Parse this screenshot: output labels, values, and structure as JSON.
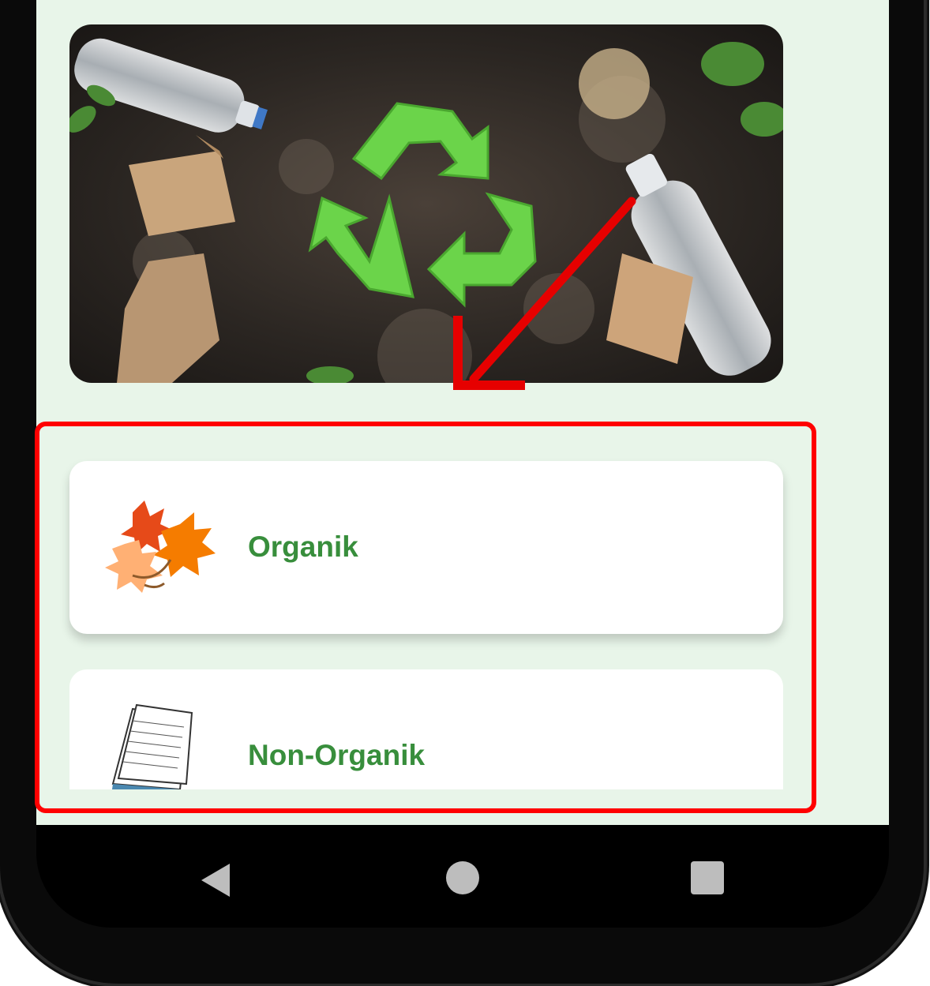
{
  "hero": {
    "image_subject": "recycling-symbol-with-bottles-and-paper-bags",
    "icon": "recycle-icon"
  },
  "categories": [
    {
      "label": "Organik",
      "icon": "autumn-leaves-icon"
    },
    {
      "label": "Non-Organik",
      "icon": "paper-stack-icon"
    }
  ],
  "nav": {
    "back_icon": "back-triangle-icon",
    "home_icon": "home-circle-icon",
    "recents_icon": "recents-square-icon"
  },
  "colors": {
    "screen_bg": "#e8f5e9",
    "label_green": "#388e3c",
    "highlight_red": "#ff0000",
    "recycle_green": "#6bd44a"
  }
}
